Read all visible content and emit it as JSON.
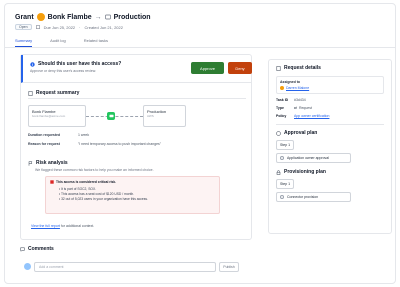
{
  "header": {
    "grant_label": "Grant",
    "user_name": "Bonk Flambe",
    "arrow": "→",
    "resource_name": "Production"
  },
  "meta": {
    "status": "Open",
    "due": "Due Jun 25, 2022",
    "created": "Created Jun 21, 2022"
  },
  "tabs": [
    "Summary",
    "Audit log",
    "Related tasks"
  ],
  "ask": {
    "question": "Should this user have this access?",
    "subtitle": "Approve or deny this user's access review.",
    "approve_label": "Approve",
    "deny_label": "Deny"
  },
  "request_summary": {
    "title": "Request summary",
    "user_node": {
      "name": "Bonk Flambe",
      "email": "bonk.flambe@acme.com"
    },
    "resource_node": {
      "name": "Production",
      "sub": "AWS"
    },
    "duration_label": "Duration requested",
    "duration_value": "1 week",
    "reason_label": "Reason for request",
    "reason_value": "\"I need temporary access to push important changes\""
  },
  "risk": {
    "title": "Risk analysis",
    "subtitle": "We flagged these common risk factors to help you make an informed choice.",
    "headline": "This access is considered critical risk.",
    "bullets": [
      "It is part of SOC2, SOX.",
      "This access has a seat cost of $120 USD / month.",
      "32 out of 5,023 users in your organization have this access."
    ],
    "link": "View the full report",
    "link_suffix": "for additional context."
  },
  "comments": {
    "title": "Comments",
    "placeholder": "Add a comment",
    "publish_label": "Publish"
  },
  "details": {
    "title": "Request details",
    "assigned_label": "Assigned to",
    "assignee": "Darren Malone",
    "task_id_label": "Task ID",
    "task_id": "#3d434",
    "type_label": "Type",
    "type_value": "Request",
    "policy_label": "Policy",
    "policy_value": "App owner certification"
  },
  "approval_plan": {
    "title": "Approval plan",
    "step": "Step 1",
    "item": "Application owner approval"
  },
  "provisioning_plan": {
    "title": "Provisioning plan",
    "step": "Step 1",
    "item": "Connector provision"
  },
  "colors": {
    "approve": "#2e7d32",
    "deny": "#c2410c",
    "accent": "#2563eb",
    "risk_bg": "#fdf3f3"
  }
}
